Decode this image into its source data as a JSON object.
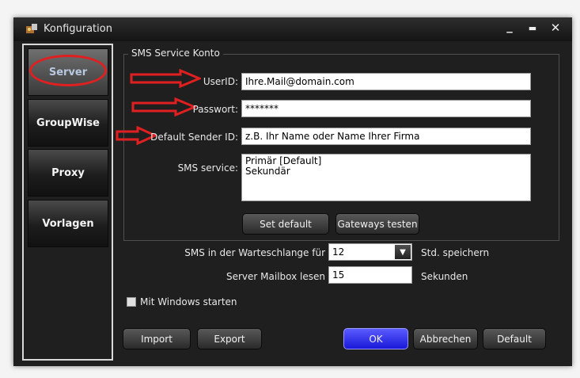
{
  "window": {
    "title": "Konfiguration",
    "min_glyph": "_",
    "max_glyph": "▬",
    "close_glyph": "✕"
  },
  "sidebar": {
    "items": [
      {
        "label": "Server"
      },
      {
        "label": "GroupWise"
      },
      {
        "label": "Proxy"
      },
      {
        "label": "Vorlagen"
      }
    ]
  },
  "sms_group": {
    "legend": "SMS Service Konto",
    "userid_label": "UserID:",
    "userid_value": "Ihre.Mail@domain.com",
    "password_label": "Passwort:",
    "password_value": "*******",
    "sender_label": "Default Sender ID:",
    "sender_value": "z.B. Ihr Name oder Name Ihrer Firma",
    "service_label": "SMS service:",
    "service_options": [
      "Primär [Default]",
      "Sekundär"
    ],
    "set_default": "Set default",
    "test_gateways": "Gateways testen"
  },
  "queue": {
    "label": "SMS in der Warteschlange für",
    "value": "12",
    "unit": "Std. speichern"
  },
  "mailbox": {
    "label": "Server Mailbox lesen",
    "value": "15",
    "unit": "Sekunden"
  },
  "startup": {
    "label": "Mit Windows starten"
  },
  "buttons": {
    "import": "Import",
    "export": "Export",
    "ok": "OK",
    "cancel": "Abbrechen",
    "default": "Default"
  },
  "colors": {
    "annotation": "#e02020",
    "ok_button": "#2a2aff",
    "window_bg": "#1f1f1f"
  }
}
